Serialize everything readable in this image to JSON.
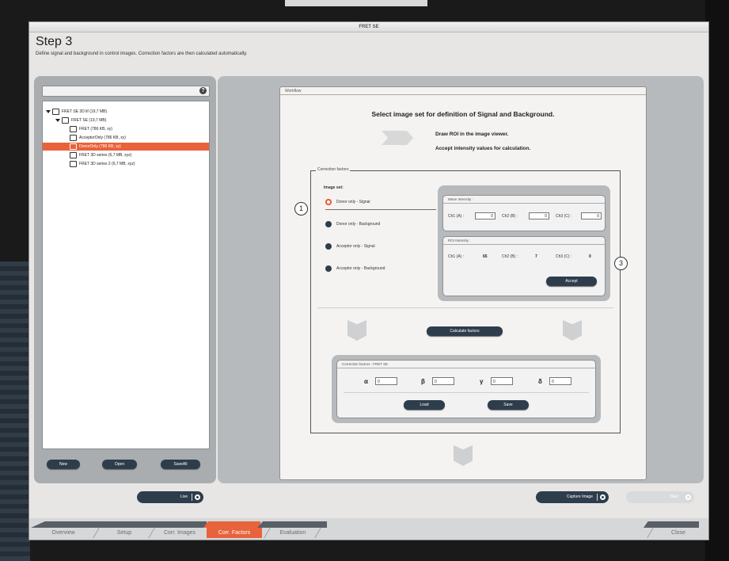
{
  "window": {
    "title": "FRET SE"
  },
  "step": {
    "title": "Step 3",
    "subtitle": "Define signal and background in control images. Correction factors are then calculated automatically."
  },
  "tree": {
    "items": [
      {
        "label": "FRET SE 3D lif (19,7 MB)",
        "level": 0,
        "expanded": true,
        "selected": false
      },
      {
        "label": "FRET SE (19,7 MB)",
        "level": 1,
        "expanded": true,
        "selected": false
      },
      {
        "label": "FRET (786 KB, xy)",
        "level": 2,
        "selected": false
      },
      {
        "label": "AcceptorOnly (786 KB, xy)",
        "level": 2,
        "selected": false
      },
      {
        "label": "DonorOnly (786 KB, xy)",
        "level": 2,
        "selected": true
      },
      {
        "label": "FRET 3D series (6,7 MB, xyz)",
        "level": 2,
        "selected": false
      },
      {
        "label": "FRET 3D series 2 (6,7 MB, xyz)",
        "level": 2,
        "selected": false
      }
    ],
    "buttons": {
      "new": "New",
      "open": "Open",
      "save_all": "SaveAll"
    }
  },
  "workflow": {
    "tab_label": "Workflow",
    "headline": "Select image set for definition of Signal and Background.",
    "instruction_1": "Draw ROI in the image viewer.",
    "instruction_2": "Accept intensity values for calculation.",
    "correction_factors_group": "Correction factors",
    "image_set_label": "Image set:",
    "radio_options": [
      {
        "label": "Donor only - Signal",
        "selected": true
      },
      {
        "label": "Donor only - Background",
        "selected": false
      },
      {
        "label": "Acceptor only - Signal",
        "selected": false
      },
      {
        "label": "Acceptor only - Background",
        "selected": false
      }
    ],
    "mean_intensity": {
      "title": "Mean Intensity :",
      "ch1_label": "Ch1 (A) :",
      "ch1_value": "0",
      "ch2_label": "Ch2 (B) :",
      "ch2_value": "0",
      "ch3_label": "Ch3 (C) :",
      "ch3_value": "0"
    },
    "roi_intensity": {
      "title": "ROI Intensity :",
      "ch1_label": "Ch1 (A) :",
      "ch1_value": "65",
      "ch2_label": "Ch2 (B) :",
      "ch2_value": "7",
      "ch3_label": "Ch3 (C) :",
      "ch3_value": "0",
      "accept_label": "Accept"
    },
    "calculate_label": "Calculate factors",
    "factors_panel": {
      "title": "Correction factors : FRET SE",
      "alpha_symbol": "α",
      "alpha_value": "0",
      "beta_symbol": "β",
      "beta_value": "0",
      "gamma_symbol": "γ",
      "gamma_value": "0",
      "delta_symbol": "δ",
      "delta_value": "0",
      "load_label": "Load",
      "save_label": "Save"
    }
  },
  "bottom": {
    "live_label": "Live",
    "capture_label": "Capture Image",
    "start_label": "Start"
  },
  "tabs": [
    "Overview",
    "Setup",
    "Corr. Images",
    "Corr. Factors",
    "Evaluation"
  ],
  "active_tab": "Corr. Factors",
  "close_label": "Close",
  "callouts": {
    "one": "1",
    "three": "3"
  },
  "colors": {
    "accent": "#e8623c",
    "button": "#2e3d4c",
    "panel": "#b7babd"
  }
}
